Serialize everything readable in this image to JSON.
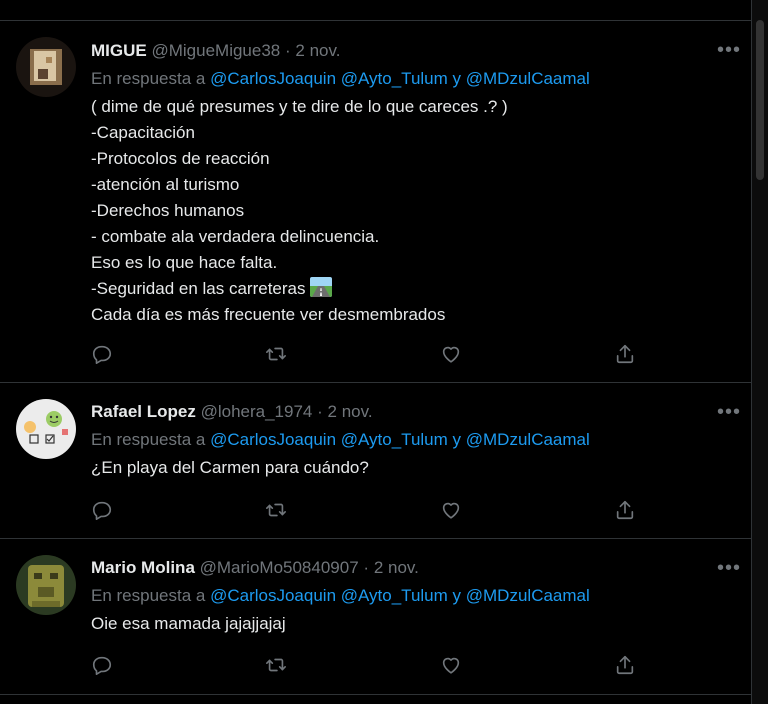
{
  "reply_prefix": "En respuesta a",
  "reply_conj": "y",
  "tweets": [
    {
      "name": "MIGUE",
      "handle": "@MigueMigue38",
      "sep": "·",
      "date": "2 nov.",
      "mentions": [
        "@CarlosJoaquin",
        "@Ayto_Tulum",
        "@MDzulCaamal"
      ],
      "lines": [
        "( dime de qué presumes y te dire de lo que careces .? )",
        "-Capacitación",
        "-Protocolos de reacción",
        "-atención al turismo",
        "-Derechos humanos",
        "- combate ala verdadera delincuencia.",
        "Eso es lo que hace falta.",
        "-Seguridad en las carreteras",
        "Cada día es más frecuente ver desmembrados"
      ],
      "emoji": "road-emoji"
    },
    {
      "name": "Rafael Lopez",
      "handle": "@lohera_1974",
      "sep": "·",
      "date": "2 nov.",
      "mentions": [
        "@CarlosJoaquin",
        "@Ayto_Tulum",
        "@MDzulCaamal"
      ],
      "lines": [
        "¿En playa del Carmen para cuándo?"
      ]
    },
    {
      "name": "Mario Molina",
      "handle": "@MarioMo50840907",
      "sep": "·",
      "date": "2 nov.",
      "mentions": [
        "@CarlosJoaquin",
        "@Ayto_Tulum",
        "@MDzulCaamal"
      ],
      "lines": [
        "Oie esa mamada jajajjajaj"
      ]
    }
  ],
  "icons": [
    "reply-icon",
    "retweet-icon",
    "like-icon",
    "share-icon",
    "more-options-icon"
  ],
  "colors": {
    "background": "#000000",
    "text": "#e7e9ea",
    "muted": "#71767b",
    "link": "#1d9bf0",
    "divider": "#2f3336"
  }
}
